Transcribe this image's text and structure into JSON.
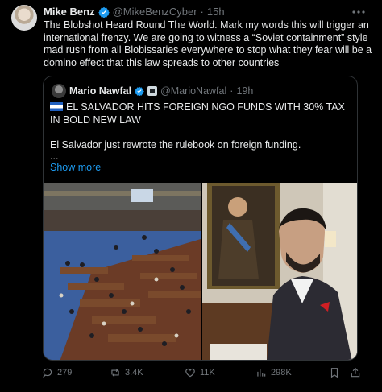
{
  "tweet": {
    "author_name": "Mike Benz",
    "handle": "@MikeBenzCyber",
    "separator": "·",
    "time": "15h",
    "text": "The Blobshot Heard Round The World. Mark my words this will trigger an international frenzy. We are going to witness a “Soviet containment” style mad rush from all Blobissaries everywhere to stop what they fear will be a domino effect that this law spreads to other countries"
  },
  "quote": {
    "author_name": "Mario Nawfal",
    "handle": "@MarioNawfal",
    "separator": "·",
    "time": "19h",
    "headline": "EL SALVADOR HITS FOREIGN NGO FUNDS WITH 30% TAX IN BOLD NEW LAW",
    "line2": "El Salvador just rewrote the rulebook on foreign funding.",
    "ellipsis": "...",
    "show_more": "Show more"
  },
  "actions": {
    "replies": "279",
    "reposts": "3.4K",
    "likes": "11K",
    "views": "298K"
  },
  "colors": {
    "background": "#000000",
    "text": "#e7e9ea",
    "muted": "#71767b",
    "accent": "#1d9bf0",
    "border": "#2f3336"
  },
  "icons": [
    "verified-badge-icon",
    "more-options-icon",
    "affiliate-badge-icon",
    "el-salvador-flag-icon",
    "reply-icon",
    "repost-icon",
    "like-icon",
    "views-icon",
    "bookmark-icon",
    "share-icon"
  ]
}
